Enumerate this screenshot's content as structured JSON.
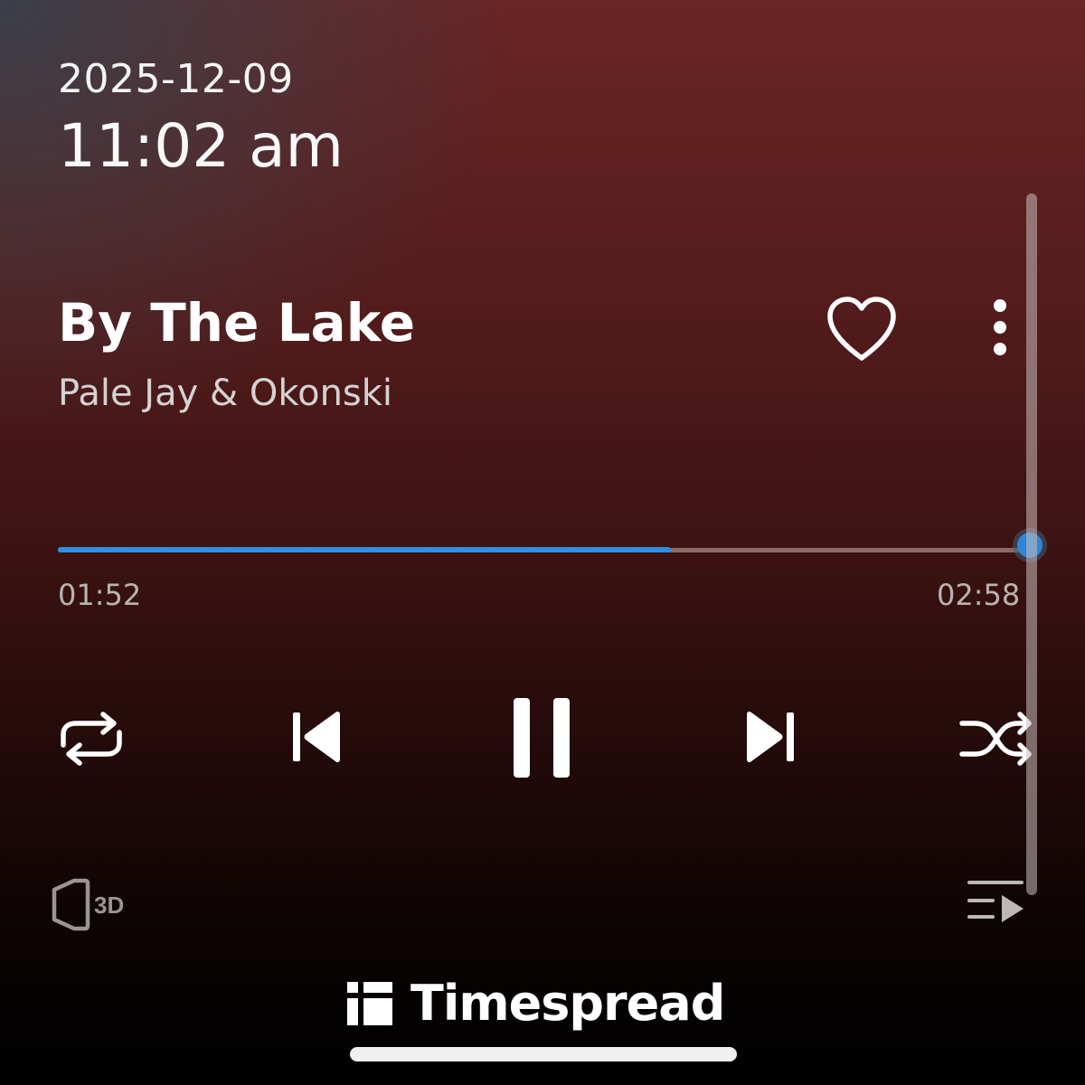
{
  "status": {
    "date": "2025-12-09",
    "time": "11:02 am"
  },
  "track": {
    "title": "By The Lake",
    "artist": "Pale Jay & Okonski"
  },
  "playback": {
    "elapsed": "01:52",
    "duration": "02:58",
    "progress_fraction": 0.63,
    "state": "playing"
  },
  "icons": {
    "like": "heart-outline-icon",
    "more": "vertical-dots-icon",
    "repeat": "repeat-icon",
    "previous": "skip-previous-icon",
    "pause": "pause-icon",
    "next": "skip-next-icon",
    "shuffle": "shuffle-icon",
    "audio3d": "speaker-3d-icon",
    "queue": "queue-icon"
  },
  "audio3d_label": "3D",
  "brand": {
    "name": "Timespread"
  },
  "colors": {
    "accent": "#2f8fe0",
    "background_top": "#6a2525",
    "background_bottom": "#000000",
    "text": "#ffffff"
  }
}
